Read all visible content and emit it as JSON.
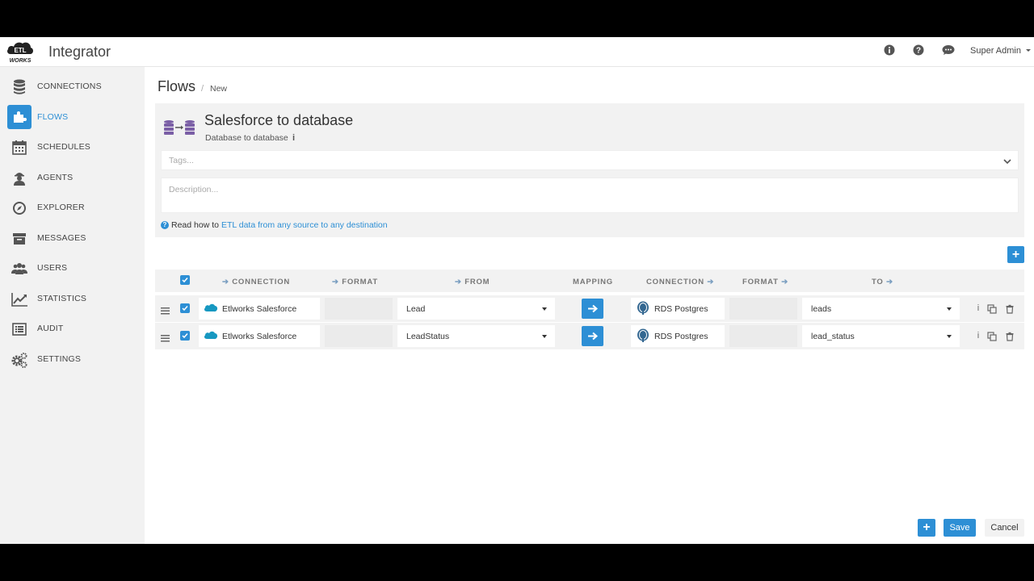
{
  "header": {
    "logo_text": "ETL WORKS",
    "app_title": "Integrator",
    "user_label": "Super Admin",
    "icons": [
      "info-icon",
      "help-icon",
      "chat-icon",
      "caret-down-icon"
    ]
  },
  "sidebar": {
    "items": [
      {
        "label": "CONNECTIONS",
        "icon": "database-icon"
      },
      {
        "label": "FLOWS",
        "icon": "puzzle-icon",
        "active": true
      },
      {
        "label": "SCHEDULES",
        "icon": "calendar-icon"
      },
      {
        "label": "AGENTS",
        "icon": "agent-icon"
      },
      {
        "label": "EXPLORER",
        "icon": "compass-icon"
      },
      {
        "label": "MESSAGES",
        "icon": "archive-icon"
      },
      {
        "label": "USERS",
        "icon": "users-icon"
      },
      {
        "label": "STATISTICS",
        "icon": "line-chart-icon"
      },
      {
        "label": "AUDIT",
        "icon": "list-icon"
      },
      {
        "label": "SETTINGS",
        "icon": "gears-icon"
      }
    ]
  },
  "breadcrumb": {
    "section": "Flows",
    "separator": "/",
    "current": "New"
  },
  "flow": {
    "name": "Salesforce to database",
    "type": "Database to database",
    "info_glyph": "i",
    "tags_placeholder": "Tags...",
    "description_placeholder": "Description...",
    "help_prefix": "Read how to",
    "help_link": "ETL data from any source to any destination"
  },
  "grid": {
    "headers": {
      "src_connection": "CONNECTION",
      "src_format": "FORMAT",
      "from": "FROM",
      "mapping": "MAPPING",
      "dst_connection": "CONNECTION",
      "dst_format": "FORMAT",
      "to": "TO"
    },
    "rows": [
      {
        "checked": true,
        "src_connection": "Etlworks Salesforce",
        "src_format": "",
        "from": "Lead",
        "dst_connection": "RDS Postgres",
        "dst_format": "",
        "to": "leads"
      },
      {
        "checked": true,
        "src_connection": "Etlworks Salesforce",
        "src_format": "",
        "from": "LeadStatus",
        "dst_connection": "RDS Postgres",
        "dst_format": "",
        "to": "lead_status"
      }
    ],
    "row_actions": {
      "info_glyph": "i"
    }
  },
  "actions": {
    "add": "+",
    "save": "Save",
    "cancel": "Cancel"
  },
  "colors": {
    "accent": "#2d8fd5",
    "sidebar_bg": "#f2f2f2",
    "panel_bg": "#f2f2f2",
    "salesforce": "#1798c1",
    "postgres": "#336791",
    "flow_icon": "#7b5fa6"
  }
}
